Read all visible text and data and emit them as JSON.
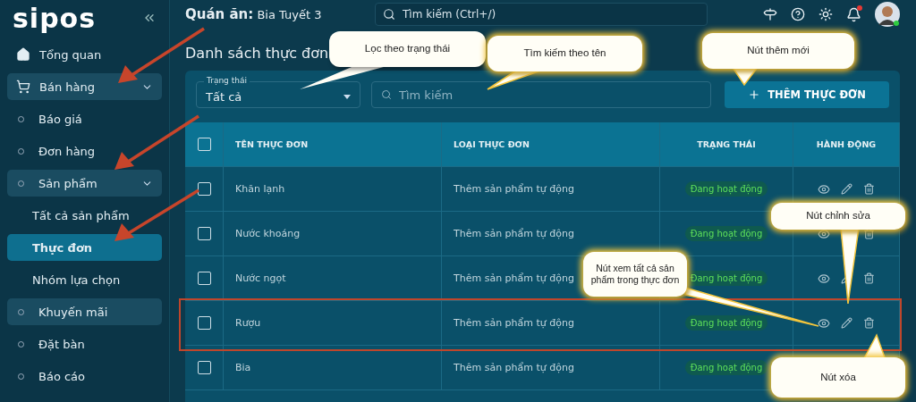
{
  "sidebar": {
    "logo": "sipos",
    "items": [
      {
        "label": "Tổng quan",
        "kind": "home",
        "highlighted": false,
        "selected": false,
        "expandable": false
      },
      {
        "label": "Bán hàng",
        "kind": "cart",
        "highlighted": true,
        "selected": false,
        "expandable": true
      },
      {
        "label": "Báo giá",
        "kind": "dot",
        "highlighted": false,
        "selected": false,
        "expandable": false
      },
      {
        "label": "Đơn hàng",
        "kind": "dot",
        "highlighted": false,
        "selected": false,
        "expandable": false
      },
      {
        "label": "Sản phẩm",
        "kind": "dot",
        "highlighted": true,
        "selected": false,
        "expandable": true
      },
      {
        "label": "Tất cả sản phẩm",
        "kind": "child",
        "highlighted": false,
        "selected": false,
        "expandable": false
      },
      {
        "label": "Thực đơn",
        "kind": "child",
        "highlighted": false,
        "selected": true,
        "expandable": false
      },
      {
        "label": "Nhóm lựa chọn",
        "kind": "child",
        "highlighted": false,
        "selected": false,
        "expandable": false
      },
      {
        "label": "Khuyến mãi",
        "kind": "dot",
        "highlighted": true,
        "selected": false,
        "expandable": false
      },
      {
        "label": "Đặt bàn",
        "kind": "dot",
        "highlighted": false,
        "selected": false,
        "expandable": false
      },
      {
        "label": "Báo cáo",
        "kind": "dot",
        "highlighted": false,
        "selected": false,
        "expandable": false
      }
    ]
  },
  "topbar": {
    "store_label": "Quán ăn:",
    "store_name": "Bia Tuyết 3",
    "search_placeholder": "Tìm kiếm (Ctrl+/)",
    "notification": true,
    "online": true
  },
  "page_title": "Danh sách thực đơn",
  "filters": {
    "status_label": "Trạng thái",
    "status_value": "Tất cả",
    "search_placeholder": "Tìm kiếm",
    "add_button": "THÊM THỰC ĐƠN"
  },
  "table": {
    "columns": [
      "TÊN THỰC ĐƠN",
      "LOẠI THỰC ĐƠN",
      "TRẠNG THÁI",
      "HÀNH ĐỘNG"
    ],
    "all_checked": false,
    "rows": [
      {
        "name": "Khăn lạnh",
        "type": "Thêm sản phẩm tự động",
        "status": "Đang hoạt động",
        "checked": false,
        "highlighted": false
      },
      {
        "name": "Nước khoáng",
        "type": "Thêm sản phẩm tự động",
        "status": "Đang hoạt động",
        "checked": false,
        "highlighted": false
      },
      {
        "name": "Nước ngọt",
        "type": "Thêm sản phẩm tự động",
        "status": "Đang hoạt động",
        "checked": false,
        "highlighted": false
      },
      {
        "name": "Rượu",
        "type": "Thêm sản phẩm tự động",
        "status": "Đang hoạt động",
        "checked": false,
        "highlighted": true
      },
      {
        "name": "Bia",
        "type": "Thêm sản phẩm tự động",
        "status": "Đang hoạt động",
        "checked": false,
        "highlighted": false,
        "actions": false
      }
    ]
  },
  "callouts": [
    {
      "text": "Lọc theo trạng thái",
      "kind": "plain"
    },
    {
      "text": "Tìm kiếm theo tên",
      "kind": "glow"
    },
    {
      "text": "Nút thêm mới",
      "kind": "glow"
    },
    {
      "text": "Nút chỉnh sửa",
      "kind": "glow"
    },
    {
      "text": "Nút xem tất cả sản phẩm trong thực đơn",
      "kind": "glow"
    },
    {
      "text": "Nút xóa",
      "kind": "glow"
    }
  ]
}
